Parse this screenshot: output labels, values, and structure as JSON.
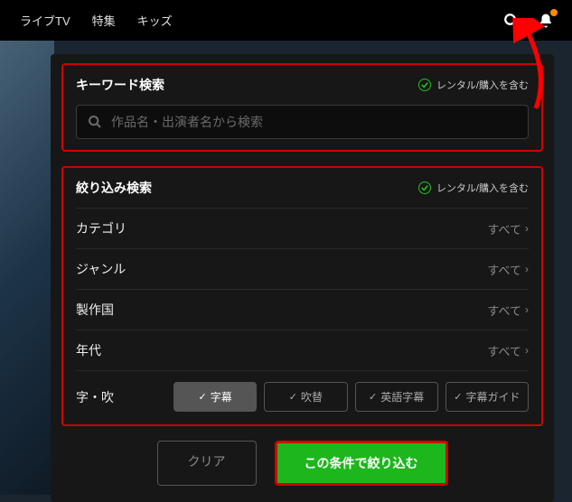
{
  "topbar": {
    "nav": [
      "ライブTV",
      "特集",
      "キッズ"
    ]
  },
  "keyword": {
    "title": "キーワード検索",
    "rental_label": "レンタル/購入を含む",
    "placeholder": "作品名・出演者名から検索"
  },
  "filter": {
    "title": "絞り込み検索",
    "rental_label": "レンタル/購入を含む",
    "rows": [
      {
        "label": "カテゴリ",
        "value": "すべて"
      },
      {
        "label": "ジャンル",
        "value": "すべて"
      },
      {
        "label": "製作国",
        "value": "すべて"
      },
      {
        "label": "年代",
        "value": "すべて"
      }
    ],
    "sub": {
      "label": "字・吹",
      "options": [
        "字幕",
        "吹替",
        "英語字幕",
        "字幕ガイド"
      ]
    }
  },
  "actions": {
    "clear": "クリア",
    "apply": "この条件で絞り込む"
  }
}
